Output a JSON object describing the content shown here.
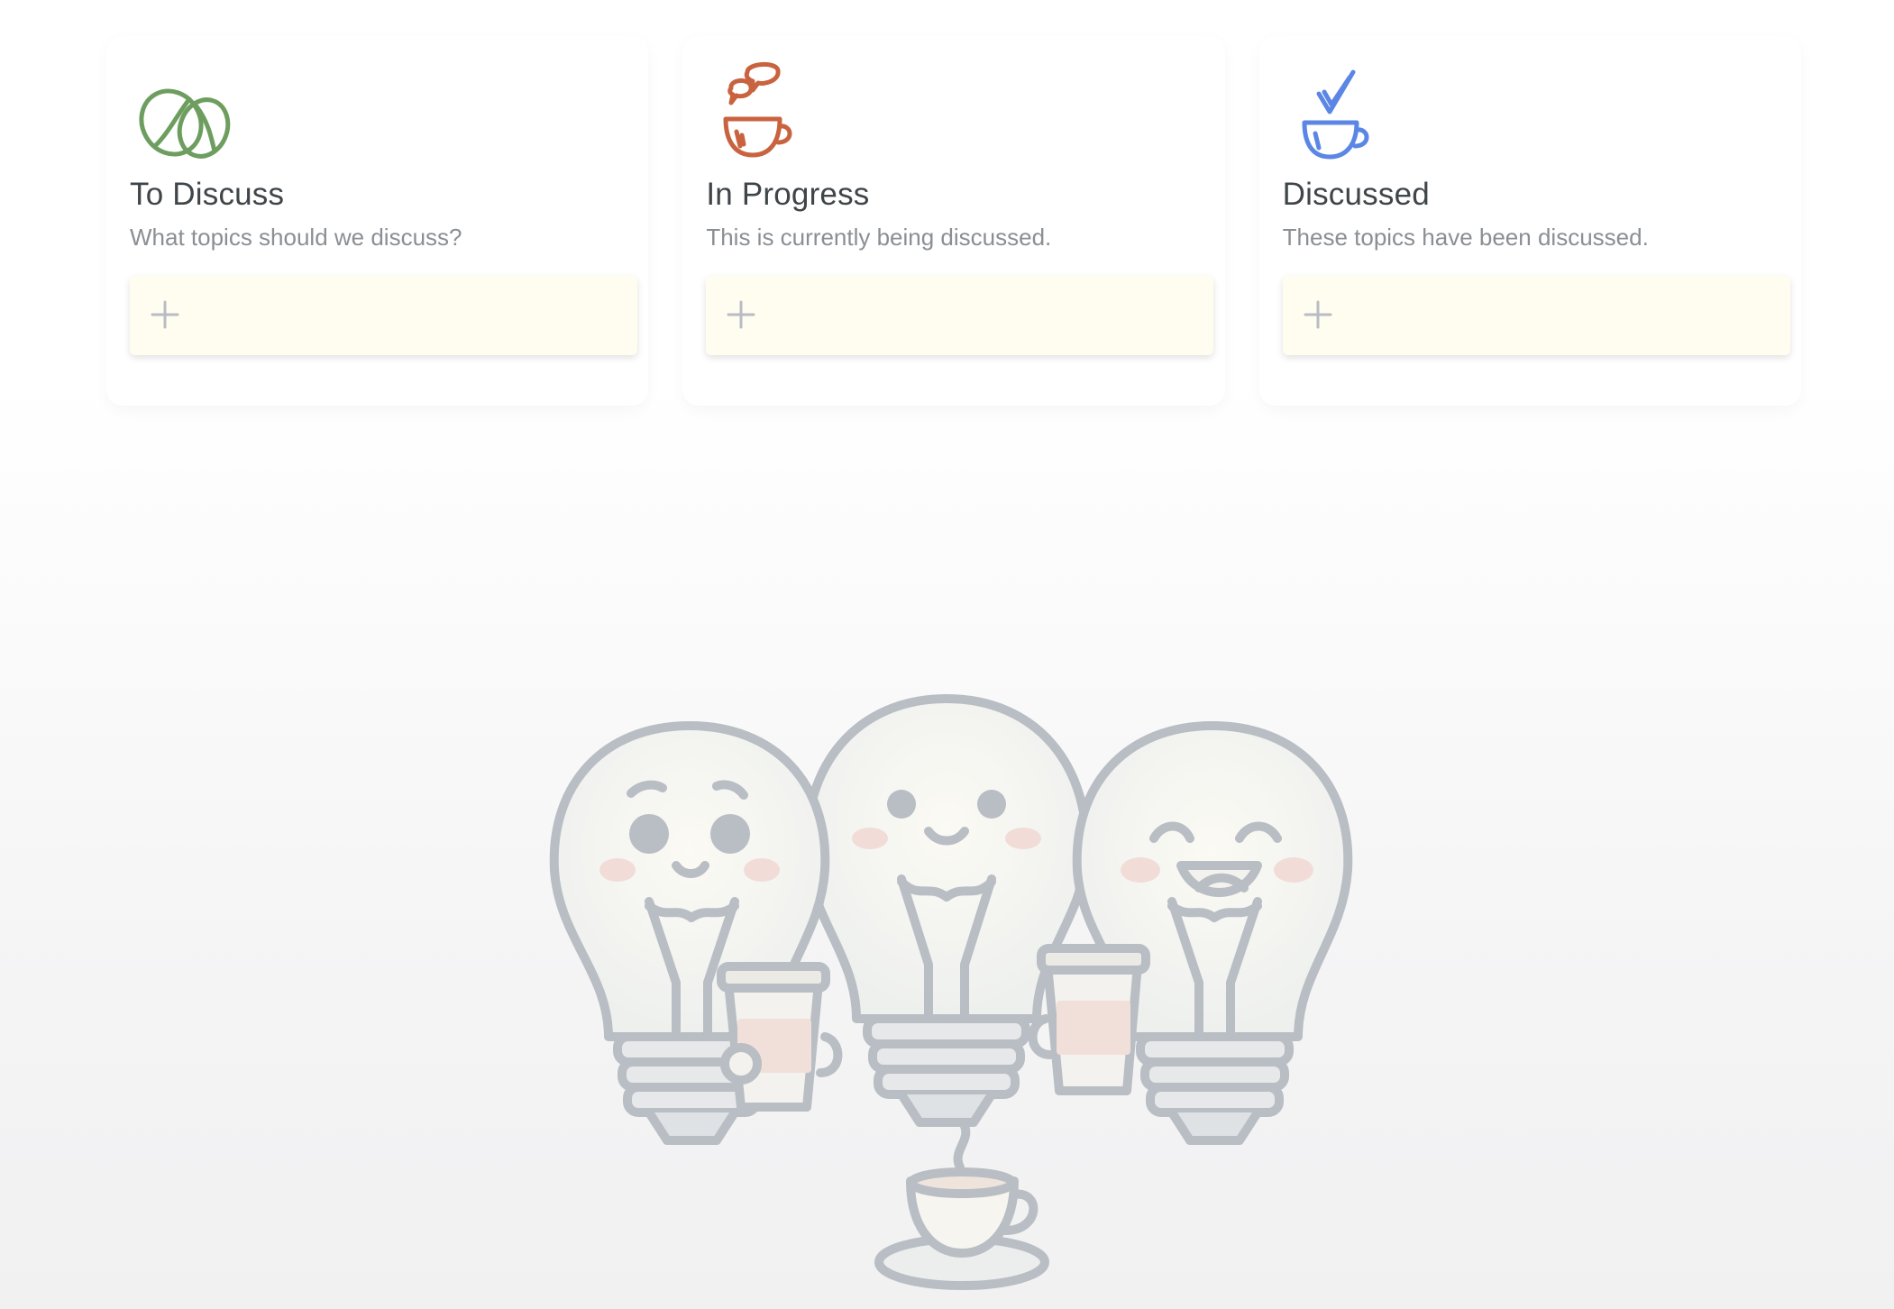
{
  "columns": [
    {
      "id": "to-discuss",
      "title": "To Discuss",
      "subtitle": "What topics should we discuss?",
      "icon": "coffee-beans-icon",
      "accent": "#6e9e5f"
    },
    {
      "id": "in-progress",
      "title": "In Progress",
      "subtitle": "This is currently being discussed.",
      "icon": "coffee-chat-icon",
      "accent": "#c9633f"
    },
    {
      "id": "discussed",
      "title": "Discussed",
      "subtitle": "These topics have been discussed.",
      "icon": "coffee-check-icon",
      "accent": "#5b86e5"
    }
  ],
  "add_card": {
    "icon": "plus-icon"
  },
  "illustration": {
    "name": "lightbulbs-coffee-illustration"
  }
}
